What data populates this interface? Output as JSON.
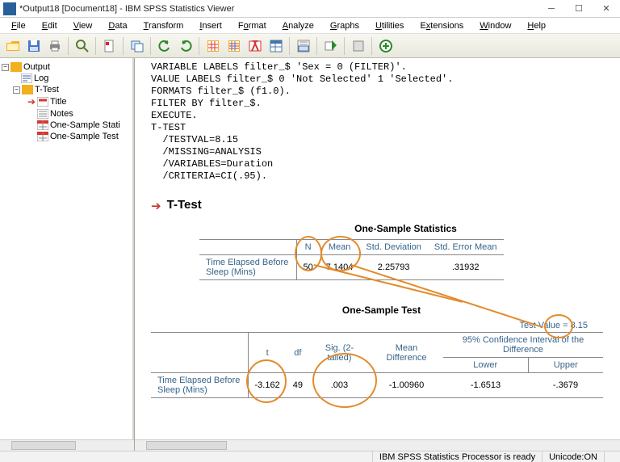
{
  "window": {
    "title": "*Output18 [Document18] - IBM SPSS Statistics Viewer"
  },
  "menu": {
    "file": "File",
    "edit": "Edit",
    "view": "View",
    "data": "Data",
    "transform": "Transform",
    "insert": "Insert",
    "format": "Format",
    "analyze": "Analyze",
    "graphs": "Graphs",
    "utilities": "Utilities",
    "extensions": "Extensions",
    "window": "Window",
    "help": "Help"
  },
  "outline": {
    "root": "Output",
    "log": "Log",
    "ttest": "T-Test",
    "title": "Title",
    "notes": "Notes",
    "stats": "One-Sample Stati",
    "test": "One-Sample Test"
  },
  "syntax": "VARIABLE LABELS filter_$ 'Sex = 0 (FILTER)'.\nVALUE LABELS filter_$ 0 'Not Selected' 1 'Selected'.\nFORMATS filter_$ (f1.0).\nFILTER BY filter_$.\nEXECUTE.\nT-TEST\n  /TESTVAL=8.15\n  /MISSING=ANALYSIS\n  /VARIABLES=Duration\n  /CRITERIA=CI(.95).",
  "section": "T-Test",
  "stats": {
    "caption": "One-Sample Statistics",
    "cols": {
      "n": "N",
      "mean": "Mean",
      "sd": "Std. Deviation",
      "se": "Std. Error Mean"
    },
    "rowlabel": "Time Elapsed Before Sleep (Mins)",
    "row": {
      "n": "50",
      "mean": "7.1404",
      "sd": "2.25793",
      "se": ".31932"
    }
  },
  "test": {
    "caption": "One-Sample Test",
    "testval": "Test Value = 8.15",
    "cols": {
      "t": "t",
      "df": "df",
      "sig": "Sig. (2-tailed)",
      "md": "Mean Difference",
      "ci": "95% Confidence Interval of the Difference",
      "lower": "Lower",
      "upper": "Upper"
    },
    "rowlabel": "Time Elapsed Before Sleep (Mins)",
    "row": {
      "t": "-3.162",
      "df": "49",
      "sig": ".003",
      "md": "-1.00960",
      "lower": "-1.6513",
      "upper": "-.3679"
    }
  },
  "status": {
    "ready": "IBM SPSS Statistics Processor is ready",
    "unicode": "Unicode:ON"
  }
}
